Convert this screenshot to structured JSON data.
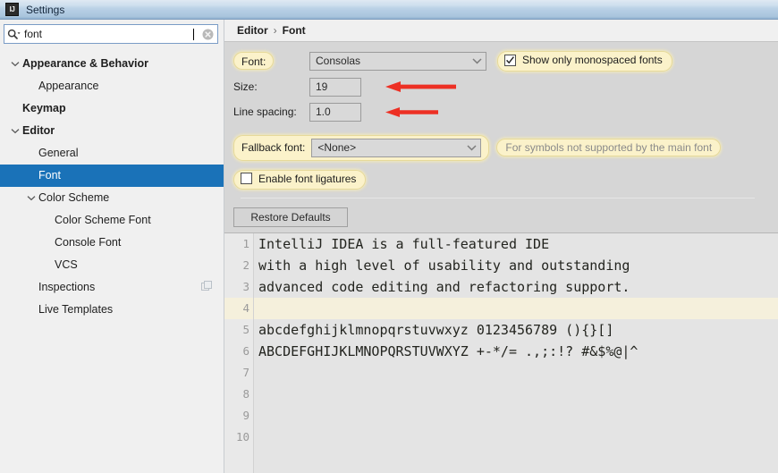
{
  "window": {
    "title": "Settings",
    "icon": "intellij-idea-icon",
    "icon_text": "IJ"
  },
  "search": {
    "value": "font",
    "placeholder": "",
    "search_icon": "search-dropdown-icon",
    "clear_icon": "clear-circle-icon"
  },
  "sidebar": {
    "items": [
      {
        "label": "Appearance & Behavior",
        "indent": 0,
        "twisty": "expanded",
        "bold": true,
        "selected": false,
        "aux": ""
      },
      {
        "label": "Appearance",
        "indent": 1,
        "twisty": "none",
        "bold": false,
        "selected": false,
        "aux": ""
      },
      {
        "label": "Keymap",
        "indent": 0,
        "twisty": "none",
        "bold": true,
        "selected": false,
        "aux": ""
      },
      {
        "label": "Editor",
        "indent": 0,
        "twisty": "expanded",
        "bold": true,
        "selected": false,
        "aux": ""
      },
      {
        "label": "General",
        "indent": 1,
        "twisty": "none",
        "bold": false,
        "selected": false,
        "aux": ""
      },
      {
        "label": "Font",
        "indent": 1,
        "twisty": "none",
        "bold": false,
        "selected": true,
        "aux": ""
      },
      {
        "label": "Color Scheme",
        "indent": 1,
        "twisty": "expanded",
        "bold": false,
        "selected": false,
        "aux": ""
      },
      {
        "label": "Color Scheme Font",
        "indent": 2,
        "twisty": "none",
        "bold": false,
        "selected": false,
        "aux": ""
      },
      {
        "label": "Console Font",
        "indent": 2,
        "twisty": "none",
        "bold": false,
        "selected": false,
        "aux": ""
      },
      {
        "label": "VCS",
        "indent": 2,
        "twisty": "none",
        "bold": false,
        "selected": false,
        "aux": ""
      },
      {
        "label": "Inspections",
        "indent": 1,
        "twisty": "none",
        "bold": false,
        "selected": false,
        "aux": "copy-icon"
      },
      {
        "label": "Live Templates",
        "indent": 1,
        "twisty": "none",
        "bold": false,
        "selected": false,
        "aux": ""
      }
    ]
  },
  "breadcrumb": {
    "parent": "Editor",
    "separator": "›",
    "current": "Font"
  },
  "font_settings": {
    "font_label": "Font:",
    "font_value": "Consolas",
    "monospaced_checkbox_label": "Show only monospaced fonts",
    "monospaced_checked": true,
    "size_label": "Size:",
    "size_value": "19",
    "line_spacing_label": "Line spacing:",
    "line_spacing_value": "1.0",
    "fallback_label": "Fallback font:",
    "fallback_value": "<None>",
    "fallback_hint": "For symbols not supported by the main font",
    "ligatures_label": "Enable font ligatures",
    "ligatures_checked": false,
    "restore_defaults_label": "Restore Defaults"
  },
  "annotations": {
    "arrow_color": "#ed3024",
    "arrows": [
      {
        "name": "size-arrow",
        "points_to": "size_value"
      },
      {
        "name": "line-spacing-arrow",
        "points_to": "line_spacing_value"
      }
    ]
  },
  "preview": {
    "lines": [
      {
        "number": "1",
        "text": "IntelliJ IDEA is a full-featured IDE",
        "caret": false
      },
      {
        "number": "2",
        "text": "with a high level of usability and outstanding",
        "caret": false
      },
      {
        "number": "3",
        "text": "advanced code editing and refactoring support.",
        "caret": false
      },
      {
        "number": "4",
        "text": "",
        "caret": true
      },
      {
        "number": "5",
        "text": "abcdefghijklmnopqrstuvwxyz 0123456789 (){}[]",
        "caret": false
      },
      {
        "number": "6",
        "text": "ABCDEFGHIJKLMNOPQRSTUVWXYZ +-*/= .,;:!? #&$%@|^",
        "caret": false
      },
      {
        "number": "7",
        "text": "",
        "caret": false
      },
      {
        "number": "8",
        "text": "",
        "caret": false
      },
      {
        "number": "9",
        "text": "",
        "caret": false
      },
      {
        "number": "10",
        "text": "",
        "caret": false
      }
    ]
  },
  "colors": {
    "selection_blue": "#1a72b8",
    "highlight_cream": "#fbf2ca",
    "panel_gray": "#d6d6d6",
    "sidebar_gray": "#f0f0f0",
    "editor_bg": "#e4e4e4",
    "caret_row": "#f5f0dc"
  }
}
